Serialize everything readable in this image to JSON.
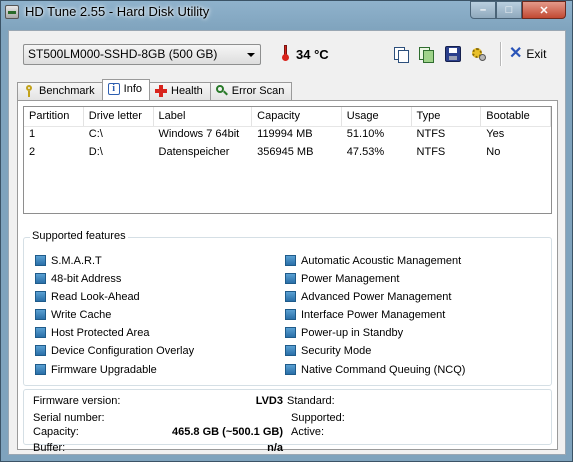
{
  "window": {
    "title": "HD Tune 2.55 - Hard Disk Utility"
  },
  "toolbar": {
    "drive": "ST500LM000-SSHD-8GB (500 GB)",
    "temperature": "34 °C",
    "exit_label": "Exit",
    "icons": [
      "copy-text-icon",
      "copy-screenshot-icon",
      "save-icon",
      "options-icon",
      "exit-icon"
    ]
  },
  "tabs": [
    {
      "label": "Benchmark",
      "icon": "benchmark-icon"
    },
    {
      "label": "Info",
      "icon": "info-icon",
      "active": true
    },
    {
      "label": "Health",
      "icon": "health-icon"
    },
    {
      "label": "Error Scan",
      "icon": "error-scan-icon"
    }
  ],
  "partitions": {
    "columns": [
      "Partition",
      "Drive letter",
      "Label",
      "Capacity",
      "Usage",
      "Type",
      "Bootable"
    ],
    "rows": [
      [
        "1",
        "C:\\",
        "Windows 7 64bit",
        "119994 MB",
        "51.10%",
        "NTFS",
        "Yes"
      ],
      [
        "2",
        "D:\\",
        "Datenspeicher",
        "356945 MB",
        "47.53%",
        "NTFS",
        "No"
      ]
    ]
  },
  "features": {
    "title": "Supported features",
    "left": [
      "S.M.A.R.T",
      "48-bit Address",
      "Read Look-Ahead",
      "Write Cache",
      "Host Protected Area",
      "Device Configuration Overlay",
      "Firmware Upgradable"
    ],
    "right": [
      "Automatic Acoustic Management",
      "Power Management",
      "Advanced Power Management",
      "Interface Power Management",
      "Power-up in Standby",
      "Security Mode",
      "Native Command Queuing (NCQ)"
    ]
  },
  "details": {
    "firmware_label": "Firmware version:",
    "firmware_value": "LVD3",
    "serial_label": "Serial number:",
    "serial_value": "",
    "capacity_label": "Capacity:",
    "capacity_value": "465.8 GB (~500.1 GB)",
    "buffer_label": "Buffer:",
    "buffer_value": "n/a",
    "standard_label": "Standard:",
    "supported_label": "Supported:",
    "active_label": "Active:"
  },
  "colors": {
    "checkbox": "#2a6fa8",
    "thermometer": "#d9241c",
    "exit_x": "#2a54b8"
  }
}
